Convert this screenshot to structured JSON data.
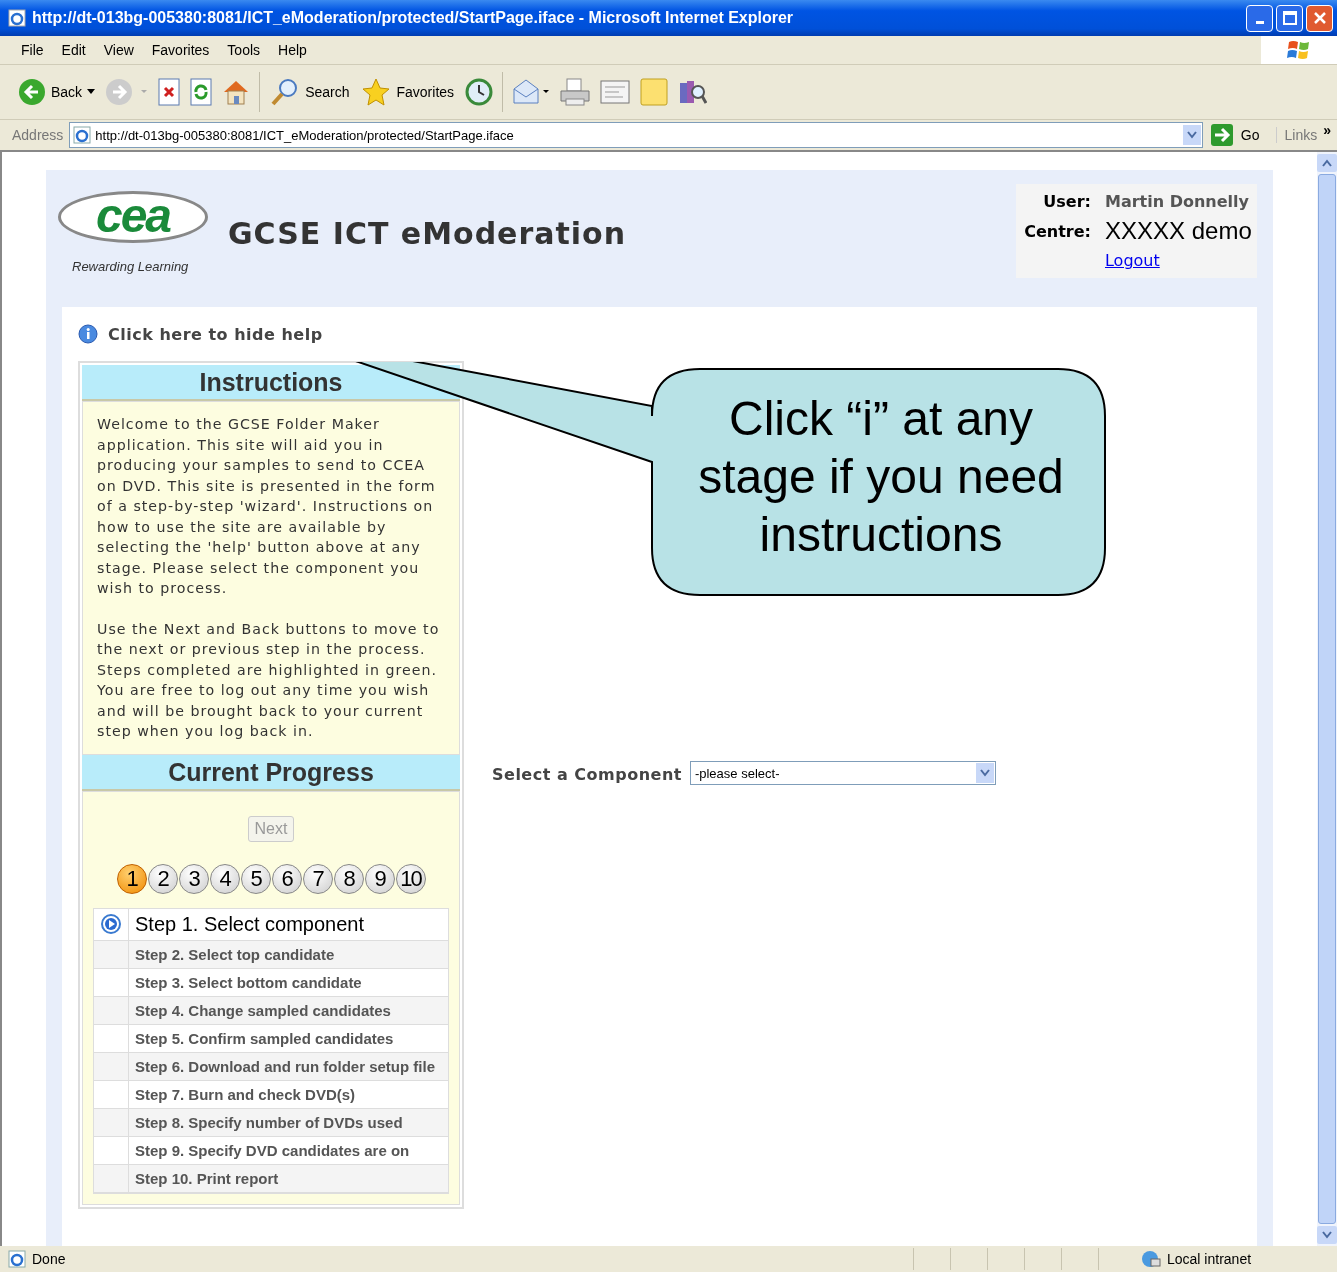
{
  "window": {
    "title": "http://dt-013bg-005380:8081/ICT_eModeration/protected/StartPage.iface - Microsoft Internet Explorer"
  },
  "menu": [
    "File",
    "Edit",
    "View",
    "Favorites",
    "Tools",
    "Help"
  ],
  "toolbar": {
    "back": "Back",
    "search": "Search",
    "favorites": "Favorites"
  },
  "address": {
    "label": "Address",
    "value": "http://dt-013bg-005380:8081/ICT_eModeration/protected/StartPage.iface",
    "go": "Go",
    "links": "Links",
    "more": "»"
  },
  "header": {
    "logo": "cea",
    "tagline": "Rewarding Learning",
    "app_title": "GCSE ICT eModeration",
    "user_label": "User:",
    "user": "Martin Donnelly",
    "centre_label": "Centre:",
    "centre": "XXXXX demo",
    "logout": "Logout"
  },
  "help_toggle": "Click here to hide help",
  "instructions": {
    "title": "Instructions",
    "paragraphs": [
      "Welcome to the GCSE Folder Maker application. This site will aid you in producing your samples to send to CCEA on DVD. This site is presented in the form of a step-by-step 'wizard'. Instructions on how to use the site are available by selecting the 'help' button above at any stage. Please select the component you wish to process.",
      "Use the Next and Back buttons to move to the next or previous step in the process. Steps completed are highlighted in green. You are free to log out any time you wish and will be brought back to your current step when you log back in."
    ]
  },
  "progress": {
    "title": "Current Progress",
    "next": {
      "label": "Next",
      "disabled": true
    },
    "step_numbers": [
      {
        "label": "1",
        "selected": true
      },
      {
        "label": "2",
        "selected": false
      },
      {
        "label": "3",
        "selected": false
      },
      {
        "label": "4",
        "selected": false
      },
      {
        "label": "5",
        "selected": false
      },
      {
        "label": "6",
        "selected": false
      },
      {
        "label": "7",
        "selected": false
      },
      {
        "label": "8",
        "selected": false
      },
      {
        "label": "9",
        "selected": false
      },
      {
        "label": "10",
        "selected": false
      }
    ],
    "steps": [
      {
        "label": "Step 1. Select component",
        "selected": true
      },
      {
        "label": "Step 2. Select top candidate",
        "selected": false
      },
      {
        "label": "Step 3. Select bottom candidate",
        "selected": false
      },
      {
        "label": "Step 4. Change sampled candidates",
        "selected": false
      },
      {
        "label": "Step 5. Confirm sampled candidates",
        "selected": false
      },
      {
        "label": "Step 6. Download and run folder setup file",
        "selected": false
      },
      {
        "label": "Step 7. Burn and check DVD(s)",
        "selected": false
      },
      {
        "label": "Step 8. Specify number of DVDs used",
        "selected": false
      },
      {
        "label": "Step 9. Specify DVD candidates are on",
        "selected": false
      },
      {
        "label": "Step 10. Print report",
        "selected": false
      }
    ]
  },
  "component": {
    "label": "Select a Component",
    "value": "-please select-"
  },
  "callout": {
    "text": "Click “i” at any stage if you need instructions"
  },
  "status_bar": {
    "status": "Done",
    "zone": "Local intranet"
  }
}
